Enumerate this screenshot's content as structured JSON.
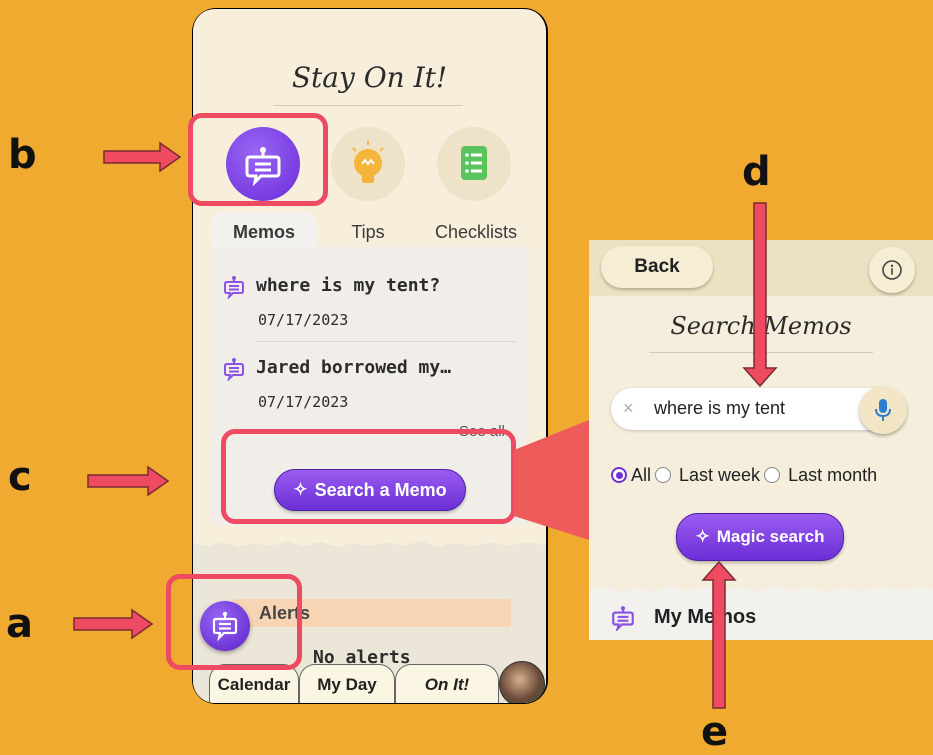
{
  "annotations": {
    "a": "a",
    "b": "b",
    "c": "c",
    "d": "d",
    "e": "e"
  },
  "app": {
    "title": "Stay On It!",
    "icons": [
      "memo-bot-icon",
      "lightbulb-icon",
      "checklist-icon"
    ],
    "tabs": [
      "Memos",
      "Tips",
      "Checklists"
    ],
    "active_tab": "Memos",
    "memos": [
      {
        "title": "where is my tent?",
        "date": "07/17/2023"
      },
      {
        "title": "Jared borrowed my…",
        "date": "07/17/2023"
      }
    ],
    "see_all": "See all",
    "search_memo_button": "Search a Memo",
    "alerts_label": "Alerts",
    "no_alerts": "No alerts",
    "bottom_tabs": [
      "Calendar",
      "My Day",
      "On It!"
    ],
    "colors": {
      "accent": "#7A3FE0",
      "highlight": "#EE4B62",
      "background": "#EFAA2F"
    }
  },
  "search_panel": {
    "back_label": "Back",
    "title": "Search Memos",
    "query": "where is my tent",
    "scope_options": [
      "All",
      "Last week",
      "Last month"
    ],
    "scope_selected": "All",
    "magic_search_button": "Magic search",
    "my_memos_label": "My Memos"
  }
}
